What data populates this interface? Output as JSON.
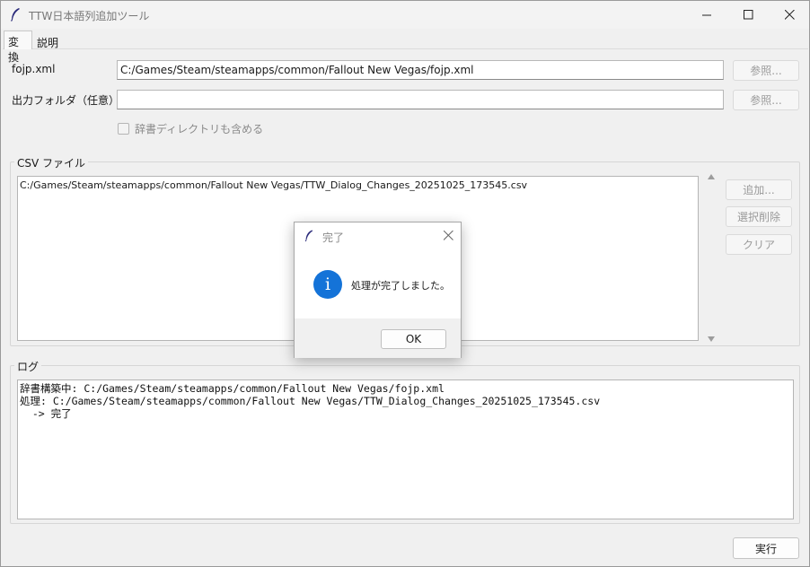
{
  "window": {
    "title": "TTW日本語列追加ツール",
    "minimize_icon": "minimize-icon",
    "maximize_icon": "maximize-icon",
    "close_icon": "close-icon"
  },
  "tabs": [
    {
      "label": "変換",
      "active": true
    },
    {
      "label": "説明",
      "active": false
    }
  ],
  "form": {
    "fojp_label": "fojp.xml",
    "fojp_value": "C:/Games/Steam/steamapps/common/Fallout New Vegas/fojp.xml",
    "fojp_browse": "参照...",
    "output_label": "出力フォルダ（任意）",
    "output_value": "",
    "output_browse": "参照...",
    "include_dict_label": "辞書ディレクトリも含める",
    "include_dict_checked": false
  },
  "csv_group": {
    "title": "CSV ファイル",
    "items": [
      "C:/Games/Steam/steamapps/common/Fallout New Vegas/TTW_Dialog_Changes_20251025_173545.csv"
    ],
    "add_button": "追加...",
    "remove_button": "選択削除",
    "clear_button": "クリア"
  },
  "log_group": {
    "title": "ログ",
    "lines": [
      "辞書構築中: C:/Games/Steam/steamapps/common/Fallout New Vegas/fojp.xml",
      "処理: C:/Games/Steam/steamapps/common/Fallout New Vegas/TTW_Dialog_Changes_20251025_173545.csv",
      "  -> 完了"
    ]
  },
  "run_button": "実行",
  "dialog": {
    "title": "完了",
    "icon": "info-icon",
    "message": "処理が完了しました。",
    "ok_button": "OK"
  },
  "colors": {
    "window_bg": "#f0f0f0",
    "info_blue": "#1473d8"
  }
}
